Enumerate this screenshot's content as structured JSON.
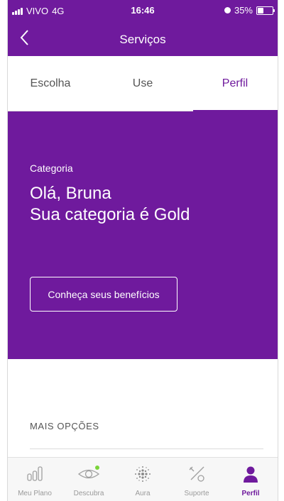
{
  "status_bar": {
    "carrier": "VIVO",
    "network": "4G",
    "time": "16:46",
    "battery": "35%",
    "battery_level": 0.35
  },
  "header": {
    "title": "Serviços"
  },
  "tabs": [
    {
      "label": "Escolha"
    },
    {
      "label": "Use"
    },
    {
      "label": "Perfil",
      "active": true
    }
  ],
  "profile": {
    "label": "Categoria",
    "greeting_line1": "Olá, Bruna",
    "greeting_line2": "Sua categoria é Gold",
    "benefits_button": "Conheça seus benefícios"
  },
  "more_options": {
    "title": "MAIS OPÇÕES"
  },
  "bottom_nav": [
    {
      "label": "Meu Plano",
      "icon": "bars-icon"
    },
    {
      "label": "Descubra",
      "icon": "eye-icon"
    },
    {
      "label": "Aura",
      "icon": "aura-dots-icon"
    },
    {
      "label": "Suporte",
      "icon": "tools-icon"
    },
    {
      "label": "Perfil",
      "icon": "user-icon",
      "active": true
    }
  ],
  "colors": {
    "primary": "#6f1a9d",
    "notification_dot": "#7ad43a"
  }
}
